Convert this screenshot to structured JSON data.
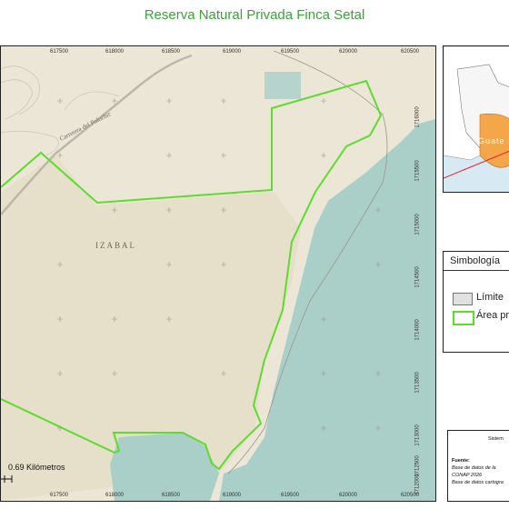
{
  "title": "Reserva Natural Privada Finca Setal",
  "map": {
    "region_label": "IZABAL",
    "road_label": "Carretera del Polochic",
    "scale_label": "0.69 Kilómetros",
    "x_ticks_top": [
      "617500",
      "618000",
      "618500",
      "619000",
      "619500",
      "620000",
      "620500"
    ],
    "x_ticks_bottom": [
      "617500",
      "618000",
      "618500",
      "619000",
      "619500",
      "620000",
      "620500"
    ],
    "y_ticks_right": [
      "1716000",
      "1715500",
      "1715000",
      "1714500",
      "1714000",
      "1713500",
      "1713000",
      "1712500",
      "1712000"
    ],
    "colors": {
      "land": "#ece6d6",
      "lowland": "#e3dcc5",
      "water": "#a9cfc8",
      "reserve_outline": "#5ddc2e",
      "contour": "#c5c0b2"
    }
  },
  "inset": {
    "label": "Guate",
    "colors": {
      "water": "#d7e9f2",
      "land": "#ffffff",
      "highlight": "#f4a64a",
      "pointer": "#e0242c"
    }
  },
  "legend": {
    "title": "Simbología",
    "items": [
      {
        "label": "Límite",
        "swatch": "limite",
        "fill": "#e0e0e0",
        "stroke": "#777777"
      },
      {
        "label": "Área pr",
        "swatch": "area",
        "fill": "#ffffff",
        "stroke": "#5ddc2e"
      }
    ]
  },
  "sources": {
    "header": "Sistem",
    "label": "Fuente:",
    "lines": [
      "Base de datos de la",
      "CONAP 2026",
      "Base de datos cartogra"
    ]
  }
}
